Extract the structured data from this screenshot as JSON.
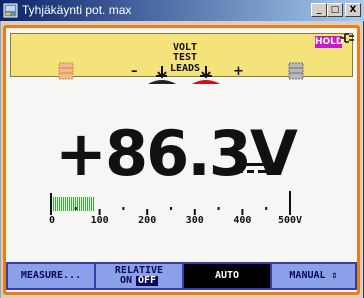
{
  "window": {
    "title": "Tyhjäkäynti pot. max",
    "min_label": "_",
    "max_label": "□",
    "close_label": "X"
  },
  "status": {
    "hold": "HOLD"
  },
  "test_leads": {
    "line1": "VOLT",
    "line2": "TEST",
    "line3": "LEADS",
    "minus": "–",
    "plus": "+"
  },
  "reading": {
    "value": "+86.3V"
  },
  "bargraph": {
    "fraction": 0.1726,
    "ticks": [
      "0",
      "100",
      "200",
      "300",
      "400",
      "500V"
    ]
  },
  "softkeys": {
    "measure": "MEASURE...",
    "relative_top": "RELATIVE",
    "relative_on": "ON",
    "relative_off": "OFF",
    "auto": "AUTO",
    "manual": "MANUAL ⇕"
  },
  "colors": {
    "frame_accent": "#ed7d12",
    "test_panel": "#f4e27a",
    "hold_badge": "#c81cc8",
    "bar_fill": "#22bb22",
    "softkey_bg": "#8aa0e8",
    "softkey_active": "#000000"
  },
  "icons": {
    "app": "fluke-app-icon",
    "plug": "plug-icon",
    "dc": "dc-symbol-icon"
  }
}
